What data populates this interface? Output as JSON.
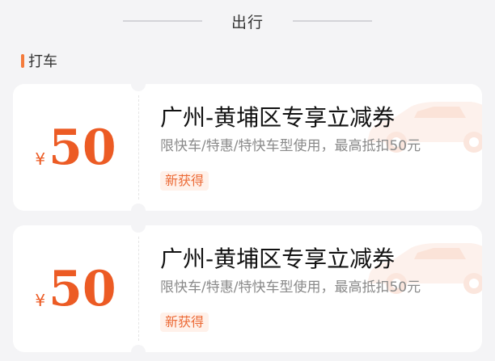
{
  "section": {
    "title": "出行"
  },
  "category": {
    "label": "打车"
  },
  "coupons": [
    {
      "currency": "¥",
      "amount": "50",
      "title": "广州-黄埔区专享立减券",
      "description": "限快车/特惠/特快车型使用，最高抵扣50元",
      "tag": "新获得",
      "icon": "car-icon"
    },
    {
      "currency": "¥",
      "amount": "50",
      "title": "广州-黄埔区专享立减券",
      "description": "限快车/特惠/特快车型使用，最高抵扣50元",
      "tag": "新获得",
      "icon": "car-icon"
    }
  ],
  "colors": {
    "accent": "#ec5b24",
    "background": "#f4f4f6",
    "tag_background": "#fff1ea"
  }
}
